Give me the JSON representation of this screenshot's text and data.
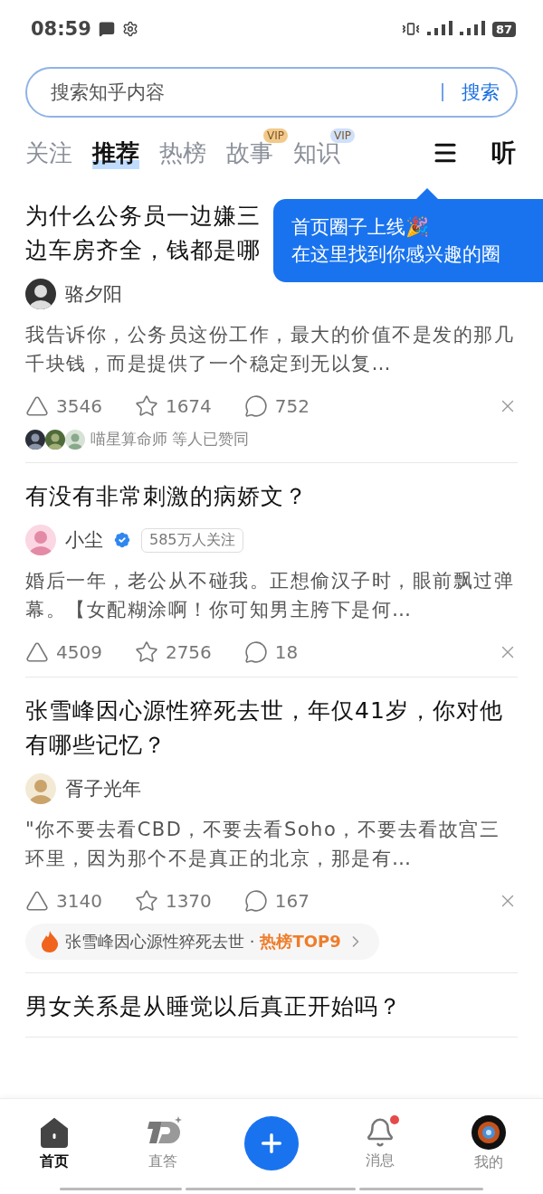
{
  "status_bar": {
    "time": "08:59",
    "battery": "87"
  },
  "search": {
    "placeholder": "搜索知乎内容",
    "button": "搜索"
  },
  "tabs": [
    {
      "label": "关注",
      "selected": false
    },
    {
      "label": "推荐",
      "selected": true
    },
    {
      "label": "热榜",
      "selected": false
    },
    {
      "label": "故事",
      "selected": false,
      "badge": "VIP",
      "color": "#f3c98a"
    },
    {
      "label": "知识",
      "selected": false,
      "badge": "VIP",
      "color": "#cfe0fb"
    }
  ],
  "listen_button": "听",
  "tooltip": {
    "title": "首页圈子上线🎉",
    "text": "在这里找到你感兴趣的圈"
  },
  "feed": [
    {
      "title_lines": [
        "为什么公务员一边嫌三",
        "边车房齐全，钱都是哪"
      ],
      "author": "骆夕阳",
      "excerpt": "我告诉你，公务员这份工作，最大的价值不是发的那几千块钱，而是提供了一个稳定到无以复…",
      "likes": "3546",
      "stars": "1674",
      "comments": "752",
      "liked_by": "喵星算命师 等人已赞同"
    },
    {
      "title": "有没有非常刺激的病娇文？",
      "author": "小尘",
      "verified": true,
      "followers": "585万人关注",
      "excerpt": "婚后一年，老公从不碰我。正想偷汉子时，眼前飘过弹幕。【女配糊涂啊！你可知男主胯下是何…",
      "likes": "4509",
      "stars": "2756",
      "comments": "18"
    },
    {
      "title": "张雪峰因心源性猝死去世，年仅41岁，你对他有哪些记忆？",
      "author": "胥子光年",
      "excerpt": "\"你不要去看CBD，不要去看Soho，不要去看故宫三环里，因为那个不是真正的北京，那是有…",
      "likes": "3140",
      "stars": "1370",
      "comments": "167",
      "hot": {
        "topic": "张雪峰因心源性猝死去世 ·",
        "rank": "热榜TOP9"
      }
    },
    {
      "title": "男女关系是从睡觉以后真正开始吗？"
    }
  ],
  "nav": [
    {
      "kind": "home",
      "label": "首页",
      "selected": true
    },
    {
      "kind": "zhida",
      "label": "直答",
      "selected": false
    },
    {
      "kind": "plus"
    },
    {
      "kind": "bell",
      "label": "消息",
      "selected": false,
      "unread": true
    },
    {
      "kind": "avatar",
      "label": "我的",
      "selected": false
    }
  ]
}
